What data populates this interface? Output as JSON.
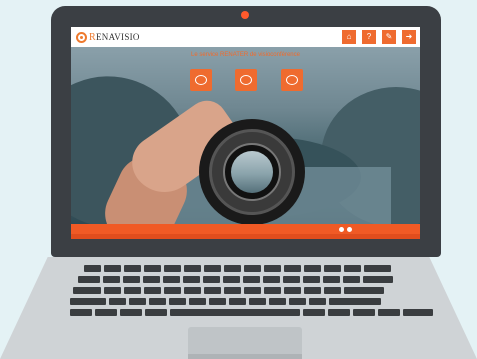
{
  "site": {
    "logo_text_cap": "R",
    "logo_text_rest": "ENAVISIO",
    "hero_title": "Le service RENATER de visioconférence",
    "features": [
      {
        "icon": "camera-icon",
        "label": ""
      },
      {
        "icon": "camera-icon",
        "label": ""
      },
      {
        "icon": "camera-icon",
        "label": ""
      }
    ],
    "nav": [
      {
        "icon": "home-icon",
        "glyph": "⌂"
      },
      {
        "icon": "help-icon",
        "glyph": "?"
      },
      {
        "icon": "tools-icon",
        "glyph": "✎"
      },
      {
        "icon": "login-icon",
        "glyph": "➜"
      }
    ],
    "footer": {
      "brand": "",
      "text": "",
      "left": "",
      "right": ""
    }
  },
  "colors": {
    "accent": "#ef6b2f",
    "footer": "#f05a25",
    "lid": "#3b3f44",
    "camera": "#ff5a2c",
    "background": "#e4f2f5"
  }
}
